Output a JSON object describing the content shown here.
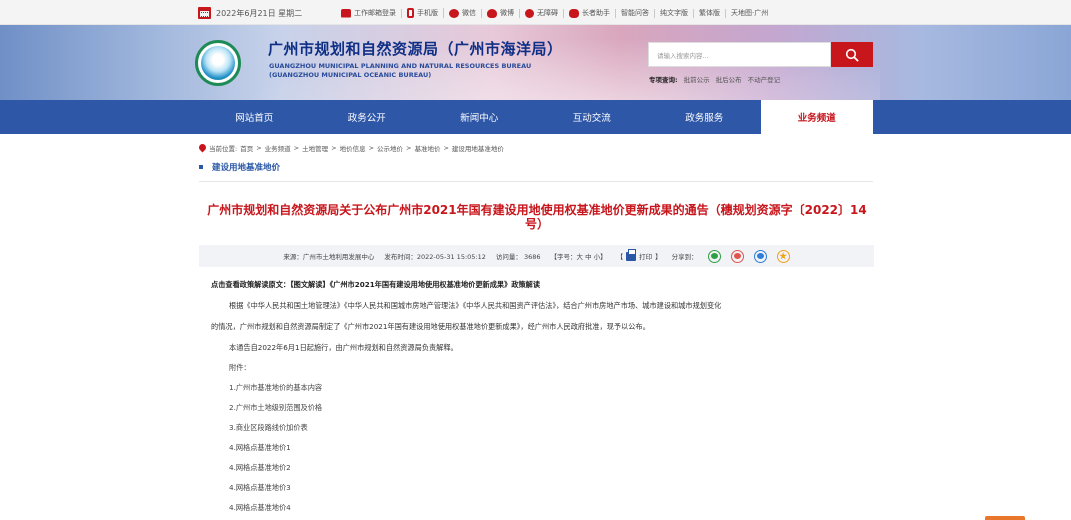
{
  "topbar": {
    "date": "2022年6月21日 星期二",
    "links": [
      "工作邮箱登录",
      "手机版",
      "微信",
      "微博",
      "无障碍",
      "长者助手",
      "智能问答",
      "纯文字版",
      "繁体版",
      "天地图·广州"
    ]
  },
  "header": {
    "title_cn": "广州市规划和自然资源局（广州市海洋局）",
    "title_en_1": "GUANGZHOU MUNICIPAL PLANNING AND NATURAL RESOURCES BUREAU",
    "title_en_2": "(GUANGZHOU MUNICIPAL OCEANIC BUREAU)",
    "search_placeholder": "请输入搜索内容...",
    "hot_label": "专项查询:",
    "hot_links": [
      "批前公示",
      "批后公布",
      "不动产登记"
    ]
  },
  "nav": {
    "items": [
      "网站首页",
      "政务公开",
      "新闻中心",
      "互动交流",
      "政务服务",
      "业务频道"
    ],
    "active_index": 5
  },
  "breadcrumb": {
    "prefix": "当前位置:",
    "items": [
      "首页",
      "业务频道",
      "土地管理",
      "地价信息",
      "公示地价",
      "基准地价",
      "建设用地基准地价"
    ]
  },
  "section": {
    "title": "建设用地基准地价"
  },
  "article": {
    "title": "广州市规划和自然资源局关于公布广州市2021年国有建设用地使用权基准地价更新成果的通告（穗规划资源字〔2022〕14号）",
    "meta": {
      "source": "来源：广州市土地利用发展中心",
      "published": "发布时间：2022-05-31 15:05:12",
      "visits": "访问量：  3686",
      "font_size": "【字号：大 中 小】",
      "print": "打印",
      "share": "分享到："
    },
    "lead": "点击查看政策解读原文：【图文解读】《广州市2021年国有建设用地使用权基准地价更新成果》政策解读",
    "para1_line1": "根据《中华人民共和国土地管理法》《中华人民共和国城市房地产管理法》《中华人民共和国资产评估法》，结合广州市房地产市场、城市建设和城市规划变化",
    "para1_line2": "的情况，广州市规划和自然资源局制定了《广州市2021年国有建设用地使用权基准地价更新成果》，经广州市人民政府批准，现予以公布。",
    "para2": "本通告自2022年6月1日起施行，由广州市规划和自然资源局负责解释。",
    "attach_label": "附件：",
    "attachments": [
      "1.广州市基准地价的基本内容",
      "2.广州市土地级别范围及价格",
      "3.商业区段路线价加价表",
      "4.网格点基准地价1",
      "4.网格点基准地价2",
      "4.网格点基准地价3",
      "4.网格点基准地价4"
    ]
  },
  "colors": {
    "accent_red": "#c8161d",
    "nav_blue": "#2e57a8",
    "title_blue": "#0f2f86"
  }
}
